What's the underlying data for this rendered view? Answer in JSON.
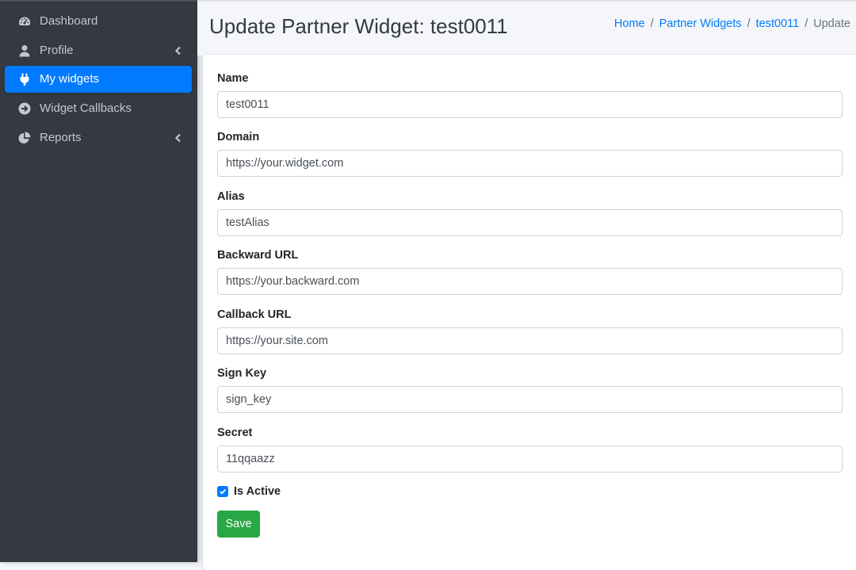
{
  "sidebar": {
    "items": [
      {
        "label": "Dashboard",
        "icon": "tachometer-icon",
        "active": false,
        "has_chevron": false
      },
      {
        "label": "Profile",
        "icon": "user-icon",
        "active": false,
        "has_chevron": true
      },
      {
        "label": "My widgets",
        "icon": "plug-icon",
        "active": true,
        "has_chevron": false
      },
      {
        "label": "Widget Callbacks",
        "icon": "arrow-circle-right-icon",
        "active": false,
        "has_chevron": false
      },
      {
        "label": "Reports",
        "icon": "chart-pie-icon",
        "active": false,
        "has_chevron": true
      }
    ]
  },
  "header": {
    "title": "Update Partner Widget: test0011",
    "breadcrumb": {
      "home": "Home",
      "partner_widgets": "Partner Widgets",
      "item": "test0011",
      "current": "Update",
      "separator": "/"
    }
  },
  "form": {
    "name": {
      "label": "Name",
      "value": "test0011"
    },
    "domain": {
      "label": "Domain",
      "value": "https://your.widget.com"
    },
    "alias": {
      "label": "Alias",
      "value": "testAlias"
    },
    "backward_url": {
      "label": "Backward URL",
      "value": "https://your.backward.com"
    },
    "callback_url": {
      "label": "Callback URL",
      "value": "https://your.site.com"
    },
    "sign_key": {
      "label": "Sign Key",
      "value": "sign_key"
    },
    "secret": {
      "label": "Secret",
      "value": "11qqaazz"
    },
    "is_active": {
      "label": "Is Active",
      "checked": true
    },
    "save_label": "Save"
  },
  "colors": {
    "sidebar_bg": "#343a40",
    "active_nav": "#007bff",
    "link": "#007bff",
    "save_button": "#28a745",
    "content_bg": "#f4f6f9"
  }
}
